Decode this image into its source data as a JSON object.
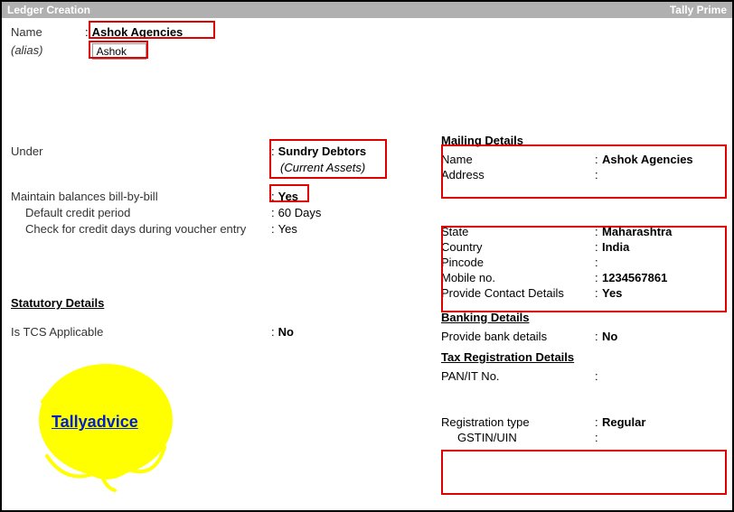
{
  "titlebar": {
    "left": "Ledger Creation",
    "right": "Tally Prime"
  },
  "header": {
    "name_label": "Name",
    "name_value": "Ashok Agencies",
    "alias_label": "(alias)",
    "alias_value": "Ashok"
  },
  "left": {
    "under_label": "Under",
    "under_value": "Sundry Debtors",
    "under_sub": "(Current Assets)",
    "billbybill_label": "Maintain balances bill-by-bill",
    "billbybill_value": "Yes",
    "credit_period_label": "Default credit period",
    "credit_period_value": "60 Days",
    "check_credit_label": "Check for credit days during voucher entry",
    "check_credit_value": "Yes",
    "statutory_head": "Statutory Details",
    "tcs_label": "Is TCS Applicable",
    "tcs_value": "No"
  },
  "right": {
    "mailing_head": "Mailing Details",
    "name_label": "Name",
    "name_value": "Ashok Agencies",
    "address_label": "Address",
    "address_value": "",
    "state_label": "State",
    "state_value": "Maharashtra",
    "country_label": "Country",
    "country_value": "India",
    "pincode_label": "Pincode",
    "pincode_value": "",
    "mobile_label": "Mobile no.",
    "mobile_value": "1234567861",
    "contact_label": "Provide Contact Details",
    "contact_value": "Yes",
    "banking_head": "Banking Details",
    "bank_label": "Provide bank details",
    "bank_value": "No",
    "tax_head": "Tax Registration Details",
    "pan_label": "PAN/IT No.",
    "pan_value": "",
    "regtype_label": "Registration type",
    "regtype_value": "Regular",
    "gstin_label": "GSTIN/UIN",
    "gstin_value": ""
  },
  "watermark": "Tallyadvice"
}
